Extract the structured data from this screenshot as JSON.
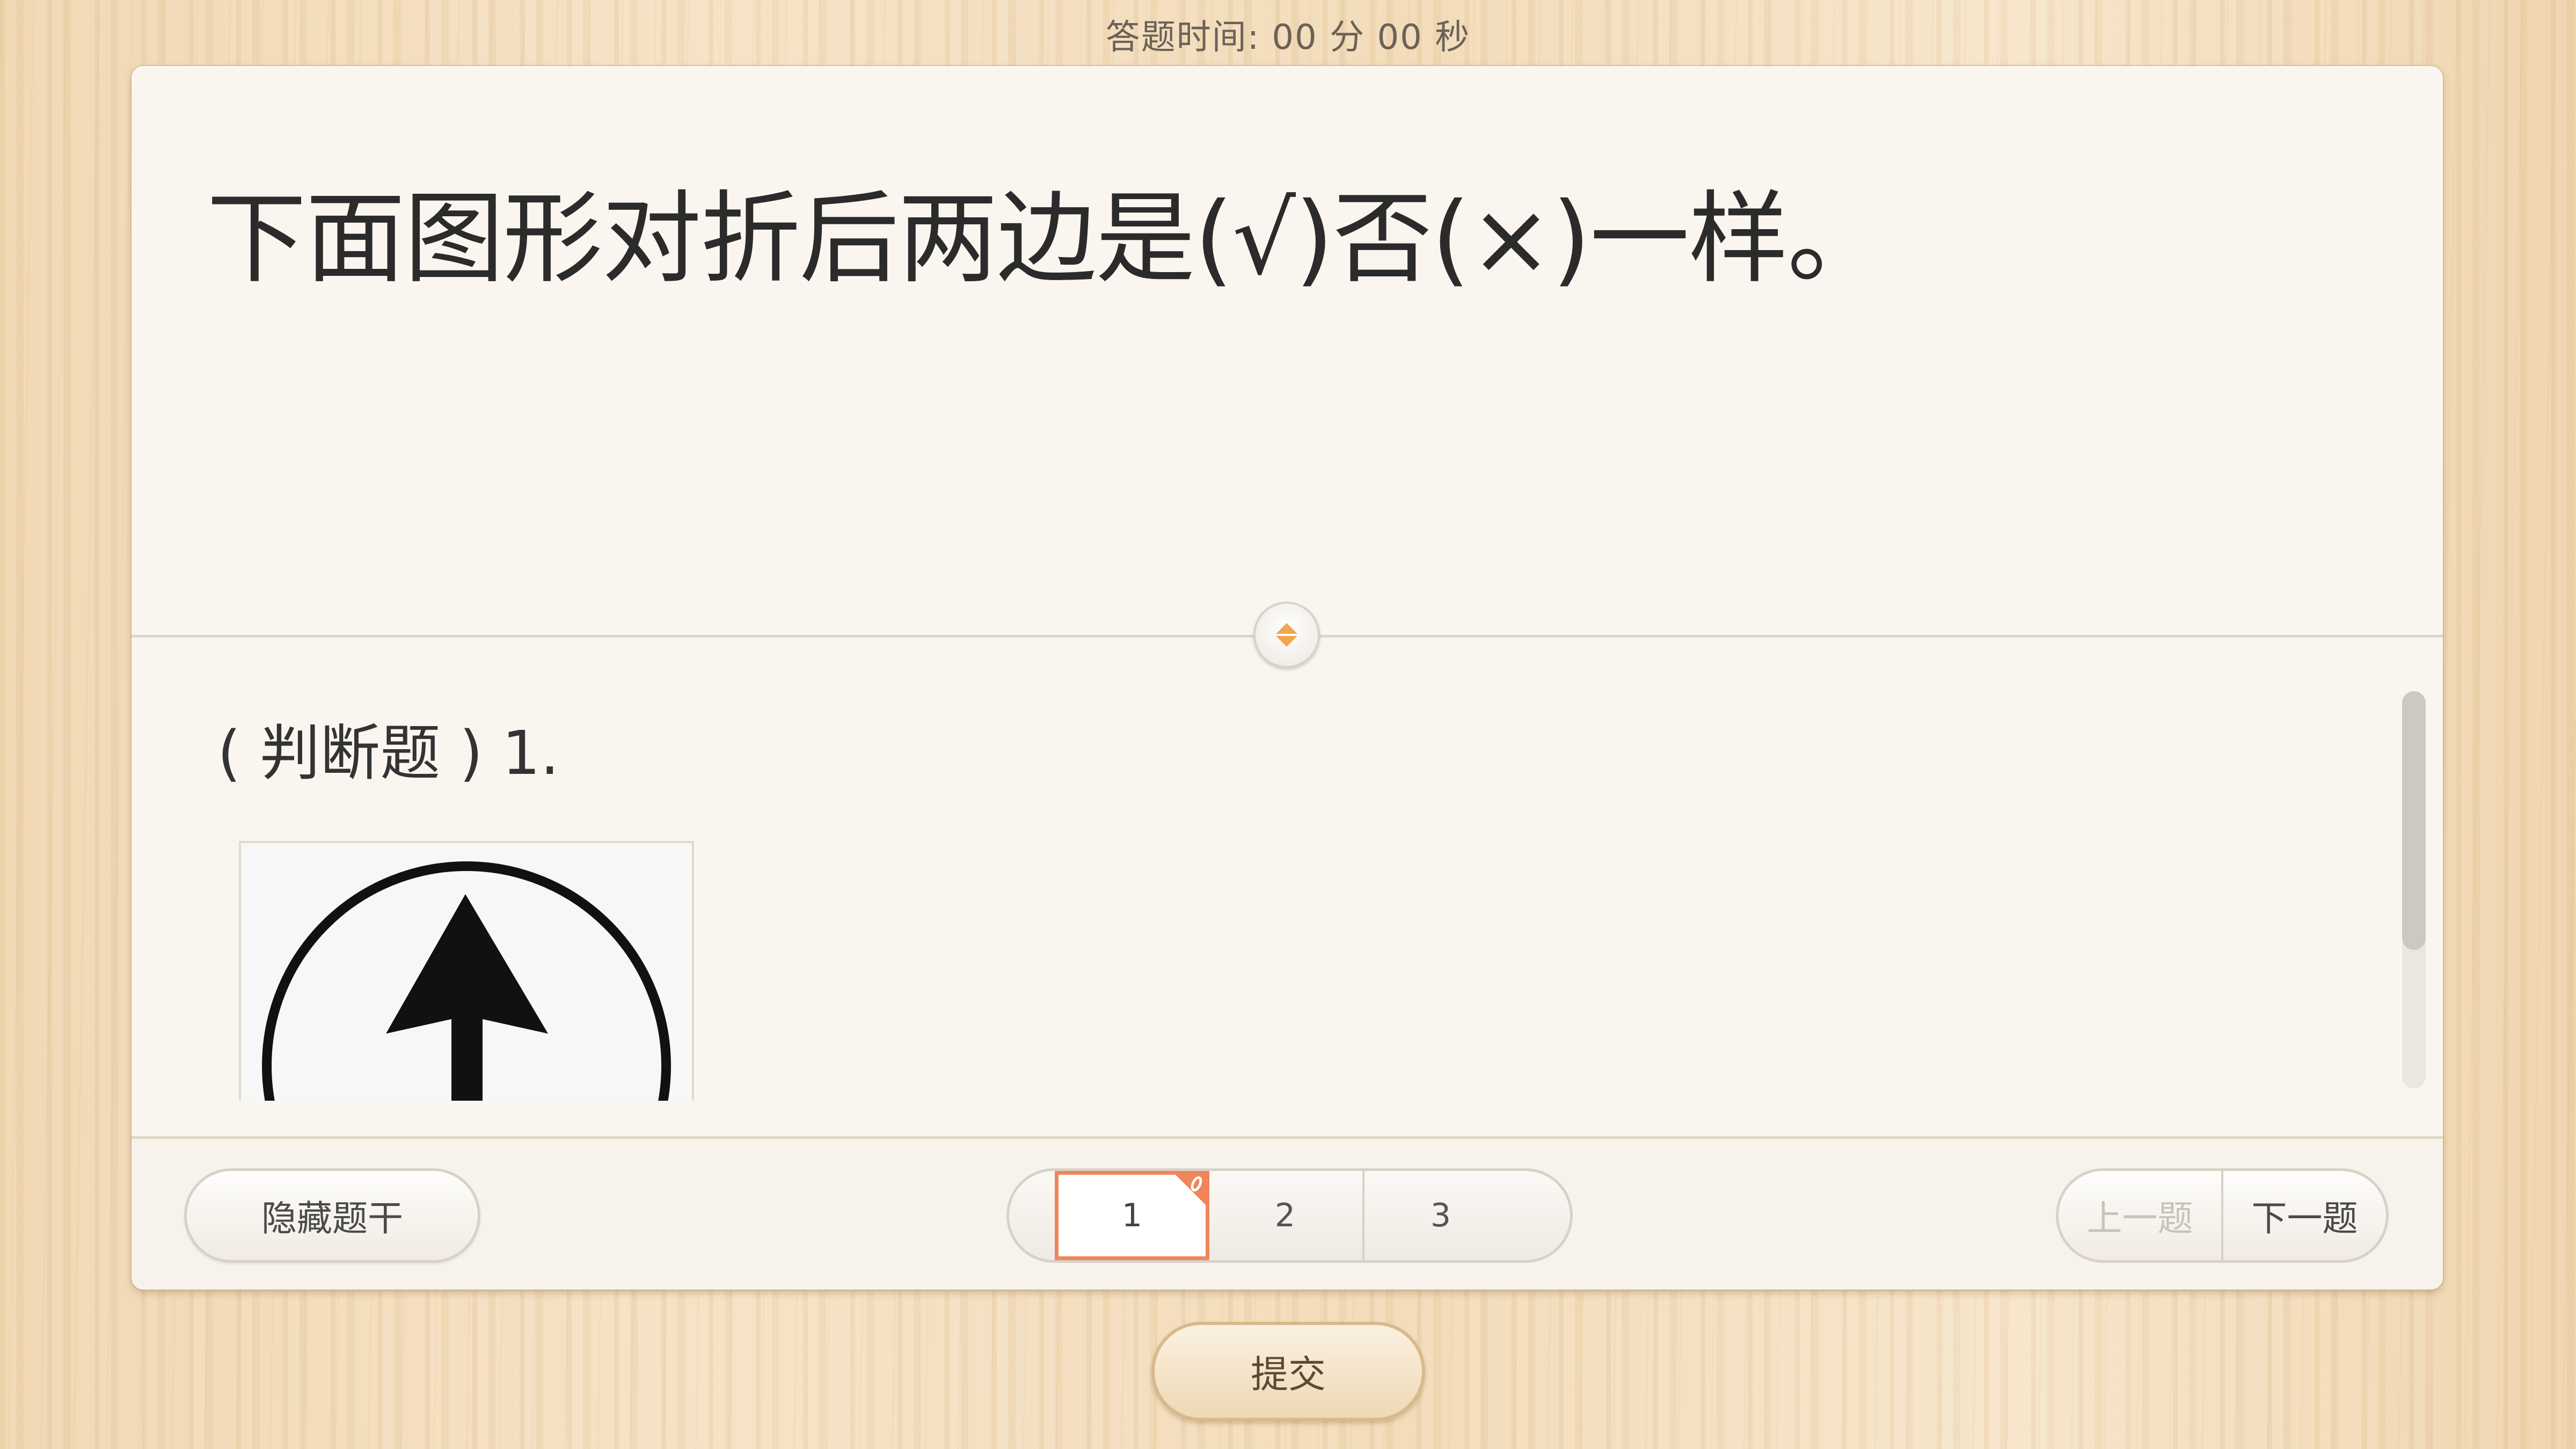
{
  "timer": {
    "label": "答题时间:",
    "value": "00 分 00 秒"
  },
  "question": {
    "text": "下面图形对折后两边是(√)否(×)一样。"
  },
  "answer": {
    "label": "( 判断题 ) 1."
  },
  "figure": {
    "icon": "up-arrow-in-circle-icon"
  },
  "footer": {
    "hide_label": "隐藏题干",
    "pages": [
      "1",
      "2",
      "3"
    ],
    "current_page": "1",
    "prev_label": "上一题",
    "next_label": "下一题"
  },
  "submit_label": "提交",
  "colors": {
    "accent": "#f0845a",
    "card": "#faf6ef",
    "wood": "#f2dbb8"
  }
}
